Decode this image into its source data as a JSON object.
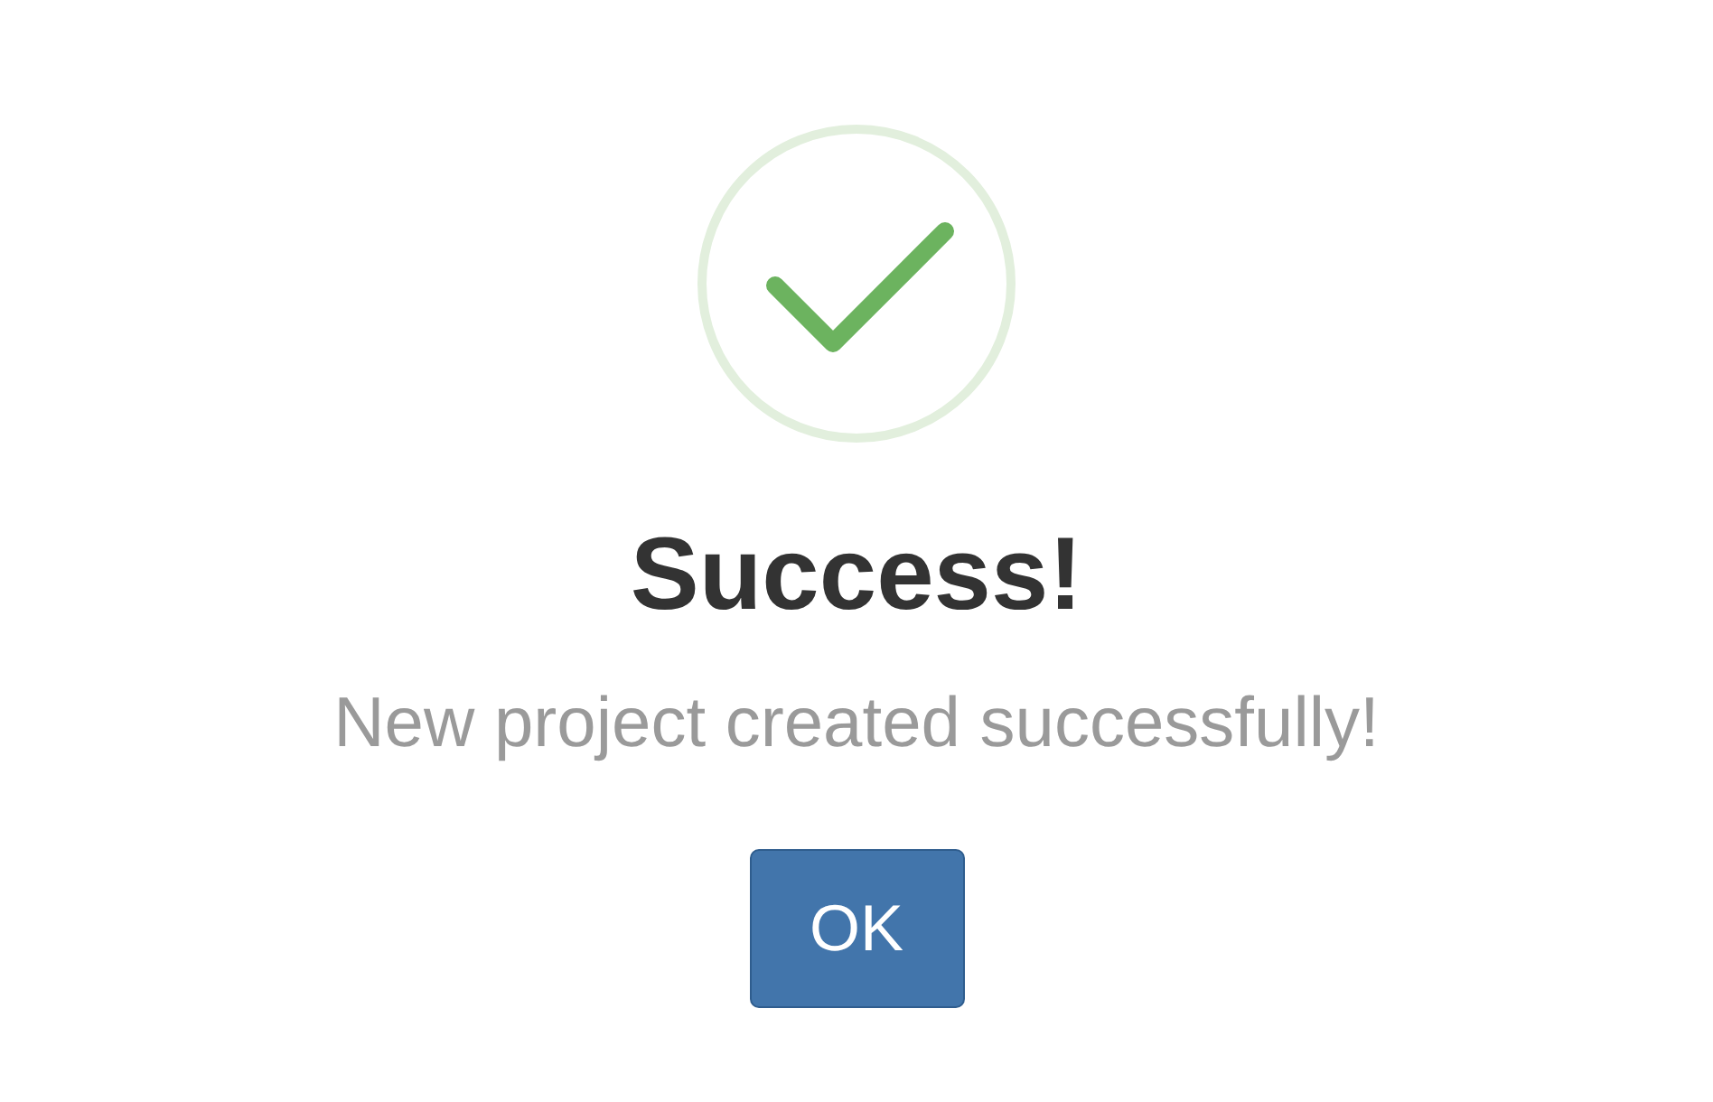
{
  "dialog": {
    "title": "Success!",
    "message": "New project created successfully!",
    "buttons": [
      "OK"
    ]
  }
}
